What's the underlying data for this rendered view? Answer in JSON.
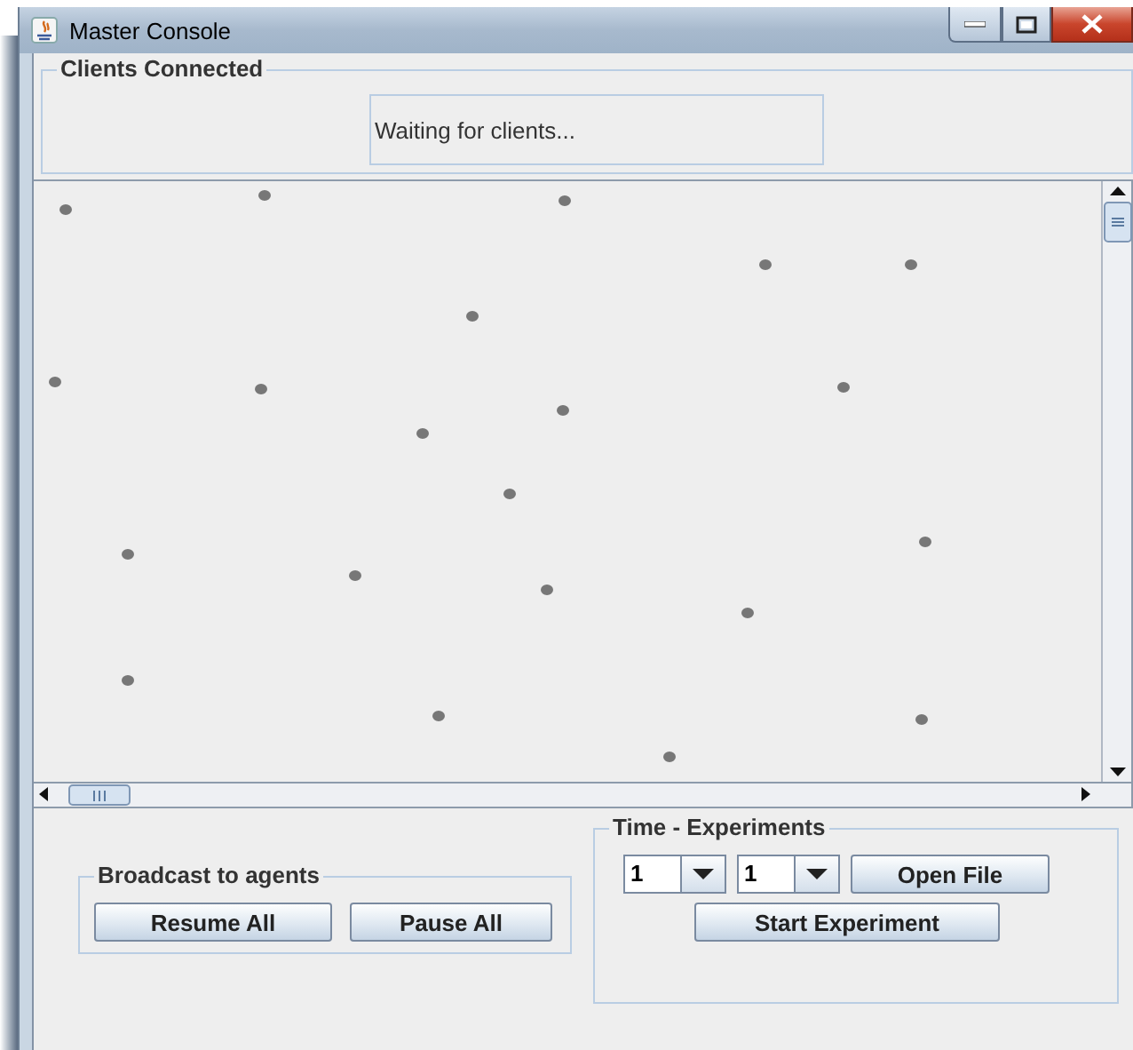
{
  "window": {
    "title": "Master Console"
  },
  "clients_panel": {
    "title": "Clients Connected",
    "status": "Waiting for clients..."
  },
  "broadcast": {
    "title": "Broadcast to agents",
    "buttons": [
      "Resume All",
      "Pause All"
    ]
  },
  "experiments": {
    "title": "Time - Experiments",
    "combos": [
      {
        "value": "1"
      },
      {
        "value": "1"
      }
    ],
    "open_button": "Open File",
    "start_button": "Start Experiment"
  }
}
